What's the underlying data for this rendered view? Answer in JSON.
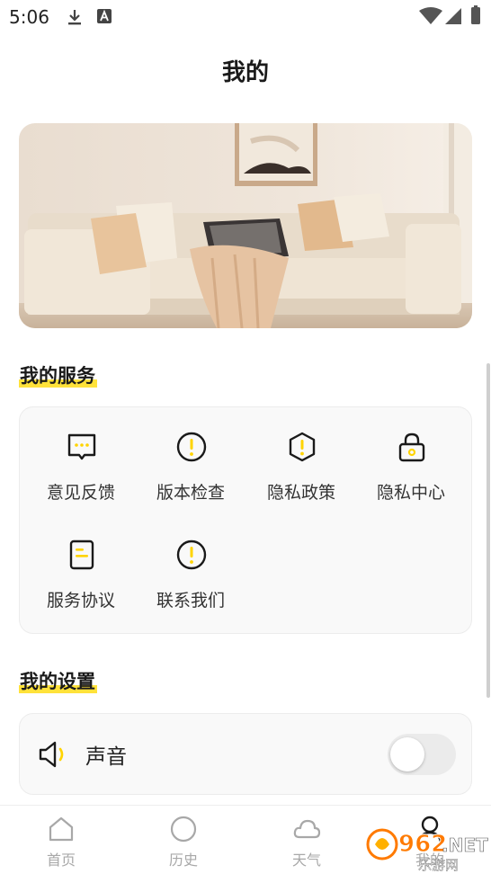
{
  "status_bar": {
    "time": "5:06",
    "icons": [
      "download-icon",
      "text-a-icon",
      "wifi-icon",
      "signal-icon",
      "battery-icon"
    ]
  },
  "page": {
    "title": "我的"
  },
  "banner": {
    "image": "beige-sofa-living-room-photo"
  },
  "services": {
    "title": "我的服务",
    "items": [
      {
        "label": "意见反馈",
        "icon": "feedback-chat-icon"
      },
      {
        "label": "版本检查",
        "icon": "info-circle-icon"
      },
      {
        "label": "隐私政策",
        "icon": "shield-hexagon-icon"
      },
      {
        "label": "隐私中心",
        "icon": "lock-icon"
      },
      {
        "label": "服务协议",
        "icon": "document-icon"
      },
      {
        "label": "联系我们",
        "icon": "info-circle-icon"
      }
    ]
  },
  "settings": {
    "title": "我的设置",
    "sound": {
      "label": "声音",
      "icon": "speaker-icon",
      "enabled": false
    }
  },
  "tabbar": {
    "tabs": [
      {
        "label": "首页",
        "icon": "home-icon",
        "active": false
      },
      {
        "label": "历史",
        "icon": "history-circle-icon",
        "active": false
      },
      {
        "label": "天气",
        "icon": "cloud-icon",
        "active": false
      },
      {
        "label": "我的",
        "icon": "profile-icon",
        "active": true
      }
    ]
  },
  "watermark": {
    "text": "962.NET",
    "subtext": "乐游网"
  },
  "colors": {
    "accent": "#ffe23a",
    "icon_stroke": "#1a1a1a",
    "toggle_off": "#ebebeb",
    "tab_inactive": "#a8a8a8"
  }
}
